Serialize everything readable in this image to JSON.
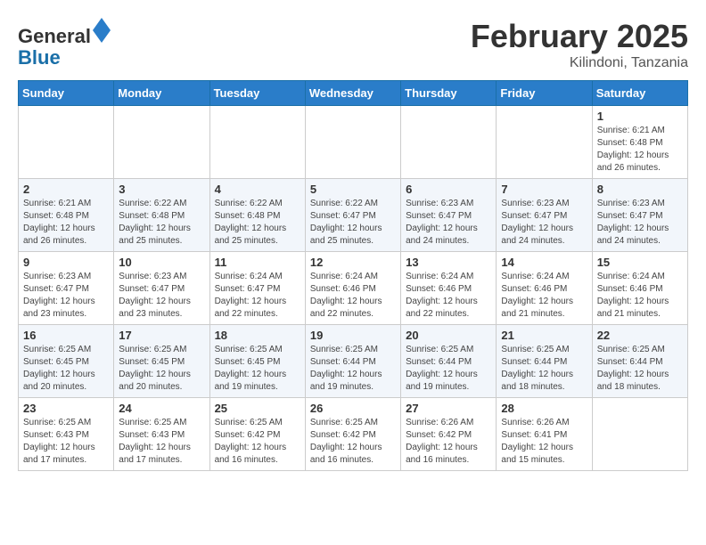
{
  "header": {
    "logo_general": "General",
    "logo_blue": "Blue",
    "month_title": "February 2025",
    "location": "Kilindoni, Tanzania"
  },
  "weekdays": [
    "Sunday",
    "Monday",
    "Tuesday",
    "Wednesday",
    "Thursday",
    "Friday",
    "Saturday"
  ],
  "weeks": [
    [
      {
        "day": "",
        "info": ""
      },
      {
        "day": "",
        "info": ""
      },
      {
        "day": "",
        "info": ""
      },
      {
        "day": "",
        "info": ""
      },
      {
        "day": "",
        "info": ""
      },
      {
        "day": "",
        "info": ""
      },
      {
        "day": "1",
        "info": "Sunrise: 6:21 AM\nSunset: 6:48 PM\nDaylight: 12 hours\nand 26 minutes."
      }
    ],
    [
      {
        "day": "2",
        "info": "Sunrise: 6:21 AM\nSunset: 6:48 PM\nDaylight: 12 hours\nand 26 minutes."
      },
      {
        "day": "3",
        "info": "Sunrise: 6:22 AM\nSunset: 6:48 PM\nDaylight: 12 hours\nand 25 minutes."
      },
      {
        "day": "4",
        "info": "Sunrise: 6:22 AM\nSunset: 6:48 PM\nDaylight: 12 hours\nand 25 minutes."
      },
      {
        "day": "5",
        "info": "Sunrise: 6:22 AM\nSunset: 6:47 PM\nDaylight: 12 hours\nand 25 minutes."
      },
      {
        "day": "6",
        "info": "Sunrise: 6:23 AM\nSunset: 6:47 PM\nDaylight: 12 hours\nand 24 minutes."
      },
      {
        "day": "7",
        "info": "Sunrise: 6:23 AM\nSunset: 6:47 PM\nDaylight: 12 hours\nand 24 minutes."
      },
      {
        "day": "8",
        "info": "Sunrise: 6:23 AM\nSunset: 6:47 PM\nDaylight: 12 hours\nand 24 minutes."
      }
    ],
    [
      {
        "day": "9",
        "info": "Sunrise: 6:23 AM\nSunset: 6:47 PM\nDaylight: 12 hours\nand 23 minutes."
      },
      {
        "day": "10",
        "info": "Sunrise: 6:23 AM\nSunset: 6:47 PM\nDaylight: 12 hours\nand 23 minutes."
      },
      {
        "day": "11",
        "info": "Sunrise: 6:24 AM\nSunset: 6:47 PM\nDaylight: 12 hours\nand 22 minutes."
      },
      {
        "day": "12",
        "info": "Sunrise: 6:24 AM\nSunset: 6:46 PM\nDaylight: 12 hours\nand 22 minutes."
      },
      {
        "day": "13",
        "info": "Sunrise: 6:24 AM\nSunset: 6:46 PM\nDaylight: 12 hours\nand 22 minutes."
      },
      {
        "day": "14",
        "info": "Sunrise: 6:24 AM\nSunset: 6:46 PM\nDaylight: 12 hours\nand 21 minutes."
      },
      {
        "day": "15",
        "info": "Sunrise: 6:24 AM\nSunset: 6:46 PM\nDaylight: 12 hours\nand 21 minutes."
      }
    ],
    [
      {
        "day": "16",
        "info": "Sunrise: 6:25 AM\nSunset: 6:45 PM\nDaylight: 12 hours\nand 20 minutes."
      },
      {
        "day": "17",
        "info": "Sunrise: 6:25 AM\nSunset: 6:45 PM\nDaylight: 12 hours\nand 20 minutes."
      },
      {
        "day": "18",
        "info": "Sunrise: 6:25 AM\nSunset: 6:45 PM\nDaylight: 12 hours\nand 19 minutes."
      },
      {
        "day": "19",
        "info": "Sunrise: 6:25 AM\nSunset: 6:44 PM\nDaylight: 12 hours\nand 19 minutes."
      },
      {
        "day": "20",
        "info": "Sunrise: 6:25 AM\nSunset: 6:44 PM\nDaylight: 12 hours\nand 19 minutes."
      },
      {
        "day": "21",
        "info": "Sunrise: 6:25 AM\nSunset: 6:44 PM\nDaylight: 12 hours\nand 18 minutes."
      },
      {
        "day": "22",
        "info": "Sunrise: 6:25 AM\nSunset: 6:44 PM\nDaylight: 12 hours\nand 18 minutes."
      }
    ],
    [
      {
        "day": "23",
        "info": "Sunrise: 6:25 AM\nSunset: 6:43 PM\nDaylight: 12 hours\nand 17 minutes."
      },
      {
        "day": "24",
        "info": "Sunrise: 6:25 AM\nSunset: 6:43 PM\nDaylight: 12 hours\nand 17 minutes."
      },
      {
        "day": "25",
        "info": "Sunrise: 6:25 AM\nSunset: 6:42 PM\nDaylight: 12 hours\nand 16 minutes."
      },
      {
        "day": "26",
        "info": "Sunrise: 6:25 AM\nSunset: 6:42 PM\nDaylight: 12 hours\nand 16 minutes."
      },
      {
        "day": "27",
        "info": "Sunrise: 6:26 AM\nSunset: 6:42 PM\nDaylight: 12 hours\nand 16 minutes."
      },
      {
        "day": "28",
        "info": "Sunrise: 6:26 AM\nSunset: 6:41 PM\nDaylight: 12 hours\nand 15 minutes."
      },
      {
        "day": "",
        "info": ""
      }
    ]
  ]
}
